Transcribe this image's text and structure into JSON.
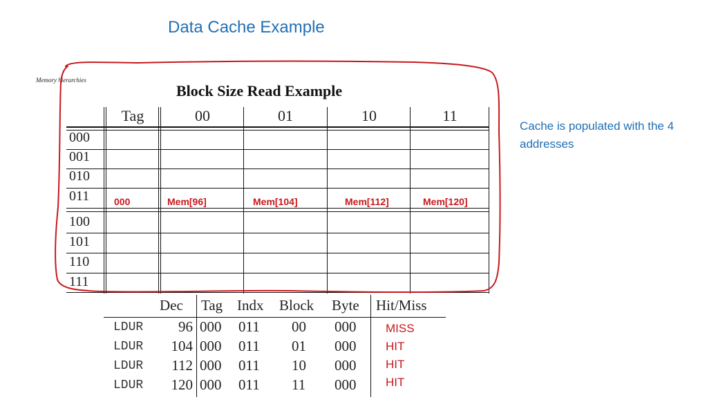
{
  "slide": {
    "title": "Data Cache Example",
    "note": "Cache is populated with the 4 addresses",
    "running_head": "Memory hierarchies",
    "figure_title": "Block Size Read Example"
  },
  "cache_table": {
    "columns": [
      "Tag",
      "00",
      "01",
      "10",
      "11"
    ],
    "row_labels": [
      "000",
      "001",
      "010",
      "011",
      "100",
      "101",
      "110",
      "111"
    ],
    "populated_row": {
      "index": "011",
      "tag": "000",
      "words": [
        "Mem[96]",
        "Mem[104]",
        "Mem[112]",
        "Mem[120]"
      ]
    }
  },
  "access_table": {
    "headers": [
      "Dec",
      "Tag",
      "Indx",
      "Block",
      "Byte",
      "Hit/Miss"
    ],
    "rows": [
      {
        "op": "LDUR",
        "dec": "96",
        "tag": "000",
        "indx": "011",
        "block": "00",
        "byte": "000",
        "result": "MISS"
      },
      {
        "op": "LDUR",
        "dec": "104",
        "tag": "000",
        "indx": "011",
        "block": "01",
        "byte": "000",
        "result": "HIT"
      },
      {
        "op": "LDUR",
        "dec": "112",
        "tag": "000",
        "indx": "011",
        "block": "10",
        "byte": "000",
        "result": "HIT"
      },
      {
        "op": "LDUR",
        "dec": "120",
        "tag": "000",
        "indx": "011",
        "block": "11",
        "byte": "000",
        "result": "HIT"
      }
    ]
  },
  "colors": {
    "title_blue": "#1f6fb5",
    "annotation_red": "#c8171b"
  }
}
